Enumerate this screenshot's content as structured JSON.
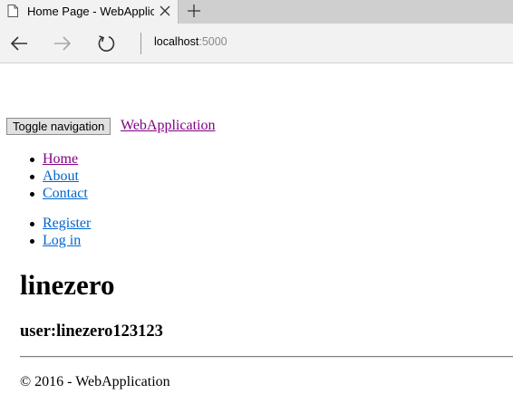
{
  "browser": {
    "tab_title": "Home Page - WebApplic",
    "tab_icon": "page-icon",
    "close_icon": "close-icon",
    "new_tab_icon": "plus-icon",
    "back_icon": "back-arrow-icon",
    "forward_icon": "forward-arrow-icon",
    "refresh_icon": "refresh-icon",
    "address_host": "localhost",
    "address_port": ":5000"
  },
  "page": {
    "toggle_label": "Toggle navigation",
    "brand": "WebApplication",
    "nav_items": [
      {
        "label": "Home",
        "visited": true
      },
      {
        "label": "About",
        "visited": false
      },
      {
        "label": "Contact",
        "visited": false
      }
    ],
    "auth_items": [
      {
        "label": "Register"
      },
      {
        "label": "Log in"
      }
    ],
    "heading": "linezero",
    "subheading": "user:linezero123123",
    "footer": "© 2016 - WebApplication"
  },
  "colors": {
    "visited_link": "#800080",
    "link": "#0066cc",
    "tab_active": "#f2f2f2",
    "tabbar": "#cfcfcf"
  }
}
